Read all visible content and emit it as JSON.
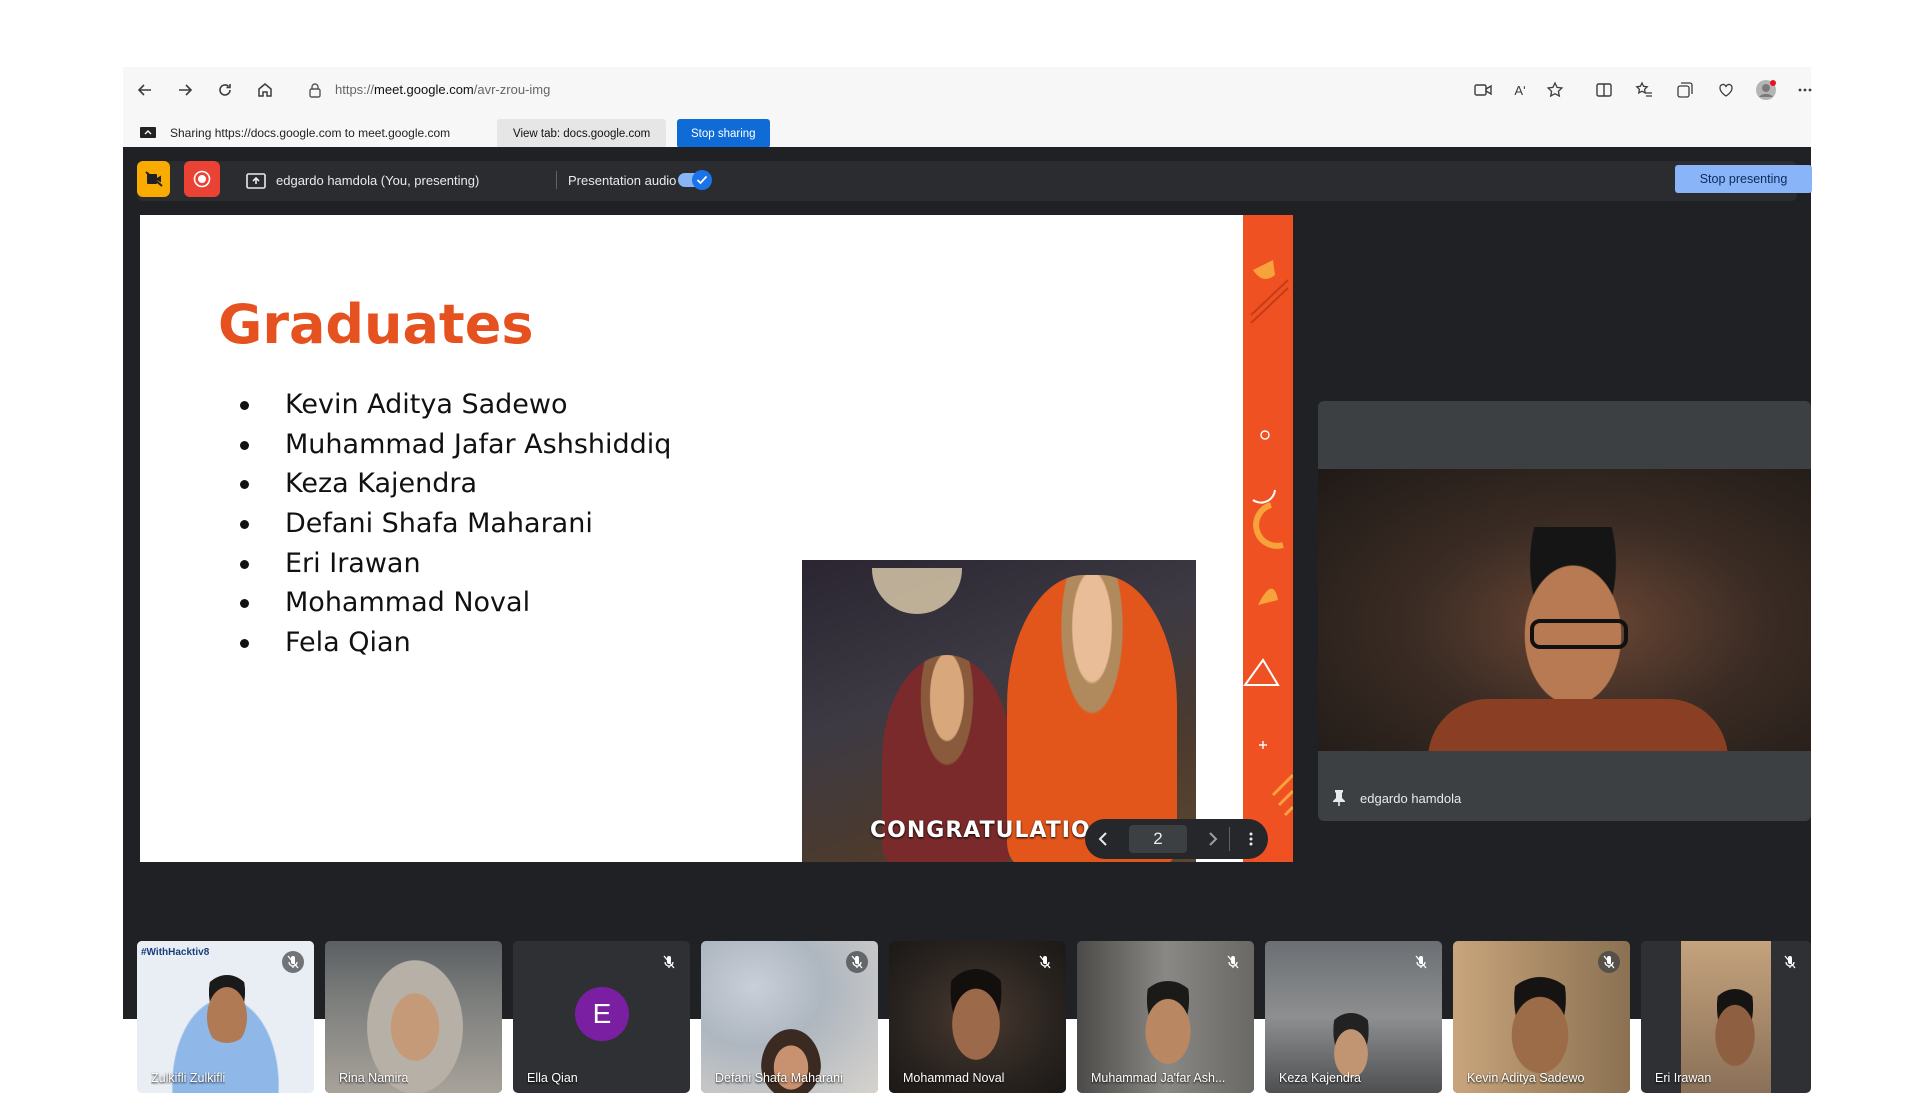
{
  "browser": {
    "url_prefix": "https://",
    "url_host": "meet.google.com",
    "url_path": "/avr-zrou-img",
    "read_aloud_icon_text": "Aʹ"
  },
  "sharebar": {
    "sharing_text": "Sharing https://docs.google.com to meet.google.com",
    "view_tab_label": "View tab: docs.google.com",
    "stop_sharing_label": "Stop sharing"
  },
  "meet": {
    "presenting_text": "edgardo hamdola (You, presenting)",
    "audio_label": "Presentation audio",
    "audio_on": true,
    "stop_presenting_label": "Stop presenting"
  },
  "slide": {
    "title": "Graduates",
    "items": [
      "Kevin Aditya Sadewo",
      "Muhammad Jafar Ashshiddiq",
      "Keza Kajendra",
      "Defani Shafa Maharani",
      "Eri Irawan",
      "Mohammad Noval",
      "Fela Qian"
    ],
    "gif_caption": "CONGRATULATIO",
    "page_number": "2"
  },
  "self_view": {
    "name": "edgardo hamdola"
  },
  "participants": [
    {
      "name": "Zulkifli Zulkifli",
      "overlay_text": "#WithHacktiv8"
    },
    {
      "name": "Rina Namira"
    },
    {
      "name": "Ella Qian",
      "avatar_letter": "E"
    },
    {
      "name": "Defani Shafa Maharani"
    },
    {
      "name": "Mohammad Noval"
    },
    {
      "name": "Muhammad Ja'far Ash..."
    },
    {
      "name": "Keza Kajendra"
    },
    {
      "name": "Kevin Aditya Sadewo"
    },
    {
      "name": "Eri Irawan"
    }
  ],
  "colors": {
    "accent_blue": "#0f6cd6",
    "slide_orange": "#e6521f",
    "meet_bg": "#202124"
  }
}
